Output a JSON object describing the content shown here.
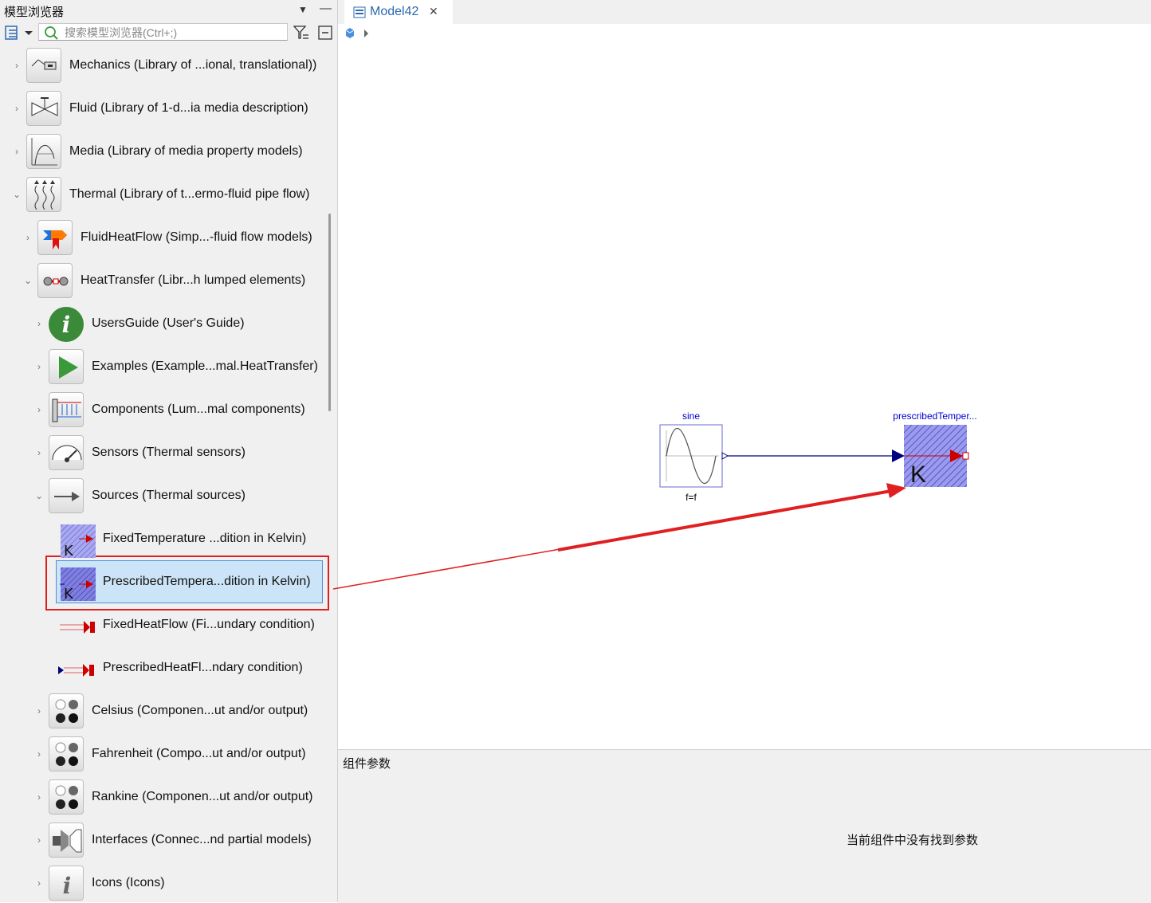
{
  "left_panel": {
    "title": "模型浏览器",
    "search_placeholder": "搜索模型浏览器(Ctrl+;)",
    "tree": [
      {
        "label": "Mechanics (Library of ...ional, translational))",
        "icon": "mechanics-icon",
        "expanded": false
      },
      {
        "label": "Fluid (Library of 1-d...ia media description)",
        "icon": "valve-icon",
        "expanded": false
      },
      {
        "label": "Media (Library of media property models)",
        "icon": "media-curve-icon",
        "expanded": false
      },
      {
        "label": "Thermal (Library of t...ermo-fluid pipe flow)",
        "icon": "heat-waves-icon",
        "expanded": true
      },
      {
        "label": "FluidHeatFlow (Simp...-fluid flow models)",
        "icon": "fluid-heat-flow-icon",
        "expanded": false
      },
      {
        "label": "HeatTransfer (Libr...h lumped elements)",
        "icon": "heat-transfer-icon",
        "expanded": true
      },
      {
        "label": "UsersGuide (User's Guide)",
        "icon": "info-icon",
        "expanded": false
      },
      {
        "label": "Examples (Example...mal.HeatTransfer)",
        "icon": "play-icon",
        "expanded": false
      },
      {
        "label": "Components (Lum...mal components)",
        "icon": "components-icon",
        "expanded": false
      },
      {
        "label": "Sensors (Thermal sensors)",
        "icon": "gauge-icon",
        "expanded": false
      },
      {
        "label": "Sources (Thermal sources)",
        "icon": "source-arrow-icon",
        "expanded": true
      },
      {
        "label": "FixedTemperature ...dition in Kelvin)",
        "icon": "fixed-temperature-icon"
      },
      {
        "label": "PrescribedTempera...dition in Kelvin)",
        "icon": "prescribed-temperature-icon",
        "selected": true
      },
      {
        "label": "FixedHeatFlow (Fi...undary condition)",
        "icon": "fixed-heat-flow-icon"
      },
      {
        "label": "PrescribedHeatFl...ndary condition)",
        "icon": "prescribed-heat-flow-icon"
      },
      {
        "label": "Celsius (Componen...ut and/or output)",
        "icon": "dots-icon",
        "expanded": false
      },
      {
        "label": "Fahrenheit (Compo...ut and/or output)",
        "icon": "dots-icon",
        "expanded": false
      },
      {
        "label": "Rankine (Componen...ut and/or output)",
        "icon": "dots-icon",
        "expanded": false
      },
      {
        "label": "Interfaces (Connec...nd partial models)",
        "icon": "interfaces-icon",
        "expanded": false
      },
      {
        "label": "Icons (Icons)",
        "icon": "icons-info-icon",
        "expanded": false
      }
    ]
  },
  "editor": {
    "tab_title": "Model42",
    "components": [
      {
        "name": "sine",
        "parameter": "f=f",
        "icon": "sine-wave-icon"
      },
      {
        "name": "prescribedTemper...",
        "icon": "prescribed-temperature-icon",
        "letter": "K"
      }
    ]
  },
  "params_panel": {
    "title": "组件参数",
    "empty_message": "当前组件中没有找到参数"
  },
  "colors": {
    "selection": "#cce4f7",
    "annotation_red": "#e02020",
    "connection_blue": "#00007f",
    "hatch_fill": "#9a9aee"
  }
}
